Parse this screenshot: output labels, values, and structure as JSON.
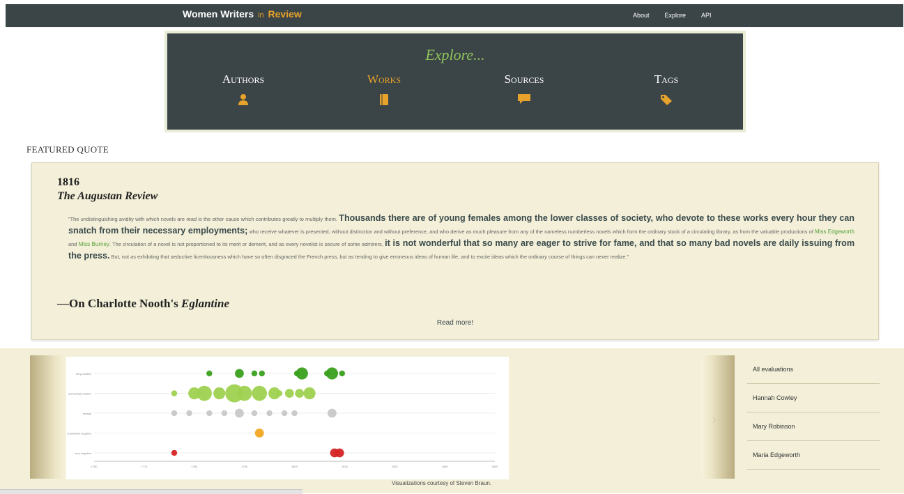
{
  "header": {
    "brand_main": "Women Writers",
    "brand_in": "in",
    "brand_review": "Review",
    "nav": [
      "About",
      "Explore",
      "API"
    ]
  },
  "explore": {
    "title": "Explore...",
    "categories": [
      {
        "label": "Authors",
        "icon": "person-icon"
      },
      {
        "label": "Works",
        "icon": "book-icon",
        "active": true
      },
      {
        "label": "Sources",
        "icon": "speech-bubble-icon"
      },
      {
        "label": "Tags",
        "icon": "tag-icon"
      }
    ]
  },
  "featured": {
    "section_label": "FEATURED QUOTE",
    "year": "1816",
    "source": "The Augustan Review",
    "quote_parts": {
      "p1": "\"The undistinguishing avidity with which novels are read is the other cause which contributes greatly to multiply them. ",
      "b1": "Thousands there are of young females among the lower classes of society, who devote to these works every hour they can snatch from their necessary employments;",
      "p2": " who receive whatever is presented, without distinction and without preference, and who derive as much pleasure from any of the nameless numberless novels which form the ordinary stock of a circulating library, as from the valuable productions of ",
      "link1": "Miss Edgeworth",
      "p3": " and ",
      "link2": "Miss Burney",
      "p4": ". The circulation of a novel is not proportioned to its merit or demerit, and as every novelist is secure of some admirers, ",
      "b2": "it is not wonderful that so many are eager to strive for fame, and that so many bad novels are daily issuing from the press.",
      "p5": " But, not as exhibiting that seductive licentiousness which have so often disgraced the French press, but as tending to give erroneous ideas of human life, and to excite ideas which the ordinary course of things can never realize.\""
    },
    "attribution_prefix": "—On Charlotte Nooth's ",
    "attribution_work": "Eglantine",
    "read_more": "Read more!"
  },
  "visualization": {
    "credit": "Visualizations courtesy of Steven Braun.",
    "left_arrow": "‹",
    "right_arrow": "›"
  },
  "evaluations": [
    "All evaluations",
    "Hannah Cowley",
    "Mary Robinson",
    "Maria Edgeworth"
  ],
  "chart_data": {
    "type": "scatter",
    "y_categories": [
      "very negative",
      "somewhat negative",
      "neutral",
      "somewhat positive",
      "very positive"
    ],
    "xlim": [
      1760,
      1840
    ],
    "x_ticks": [
      1760,
      1770,
      1780,
      1790,
      1800,
      1810,
      1820,
      1830,
      1840
    ],
    "colors": {
      "very positive": "#3aa01e",
      "somewhat positive": "#9fd150",
      "neutral": "#c8c8c8",
      "somewhat negative": "#f2a623",
      "very negative": "#d42424"
    },
    "points": [
      {
        "x": 1783,
        "y": "very positive",
        "r": 1
      },
      {
        "x": 1789,
        "y": "very positive",
        "r": 2
      },
      {
        "x": 1792,
        "y": "very positive",
        "r": 1
      },
      {
        "x": 1793.5,
        "y": "very positive",
        "r": 1
      },
      {
        "x": 1800.5,
        "y": "very positive",
        "r": 1
      },
      {
        "x": 1806.5,
        "y": "very positive",
        "r": 1
      },
      {
        "x": 1809.5,
        "y": "very positive",
        "r": 1
      },
      {
        "x": 1801.5,
        "y": "very positive",
        "r": 3
      },
      {
        "x": 1807.5,
        "y": "very positive",
        "r": 3
      },
      {
        "x": 1776,
        "y": "somewhat positive",
        "r": 1
      },
      {
        "x": 1780,
        "y": "somewhat positive",
        "r": 3
      },
      {
        "x": 1782,
        "y": "somewhat positive",
        "r": 4
      },
      {
        "x": 1785,
        "y": "somewhat positive",
        "r": 3
      },
      {
        "x": 1788,
        "y": "somewhat positive",
        "r": 5
      },
      {
        "x": 1790,
        "y": "somewhat positive",
        "r": 4
      },
      {
        "x": 1793,
        "y": "somewhat positive",
        "r": 4
      },
      {
        "x": 1796,
        "y": "somewhat positive",
        "r": 3
      },
      {
        "x": 1799,
        "y": "somewhat positive",
        "r": 2
      },
      {
        "x": 1801,
        "y": "somewhat positive",
        "r": 2
      },
      {
        "x": 1803,
        "y": "somewhat positive",
        "r": 3
      },
      {
        "x": 1797,
        "y": "somewhat positive",
        "r": 1
      },
      {
        "x": 1776,
        "y": "neutral",
        "r": 1
      },
      {
        "x": 1779,
        "y": "neutral",
        "r": 1
      },
      {
        "x": 1783,
        "y": "neutral",
        "r": 1
      },
      {
        "x": 1786,
        "y": "neutral",
        "r": 1
      },
      {
        "x": 1789,
        "y": "neutral",
        "r": 2
      },
      {
        "x": 1792,
        "y": "neutral",
        "r": 1
      },
      {
        "x": 1795,
        "y": "neutral",
        "r": 1
      },
      {
        "x": 1798,
        "y": "neutral",
        "r": 1
      },
      {
        "x": 1800,
        "y": "neutral",
        "r": 1
      },
      {
        "x": 1807.5,
        "y": "neutral",
        "r": 2
      },
      {
        "x": 1793,
        "y": "somewhat negative",
        "r": 2
      },
      {
        "x": 1776,
        "y": "very negative",
        "r": 1
      },
      {
        "x": 1808,
        "y": "very negative",
        "r": 2
      },
      {
        "x": 1809,
        "y": "very negative",
        "r": 2
      }
    ]
  }
}
